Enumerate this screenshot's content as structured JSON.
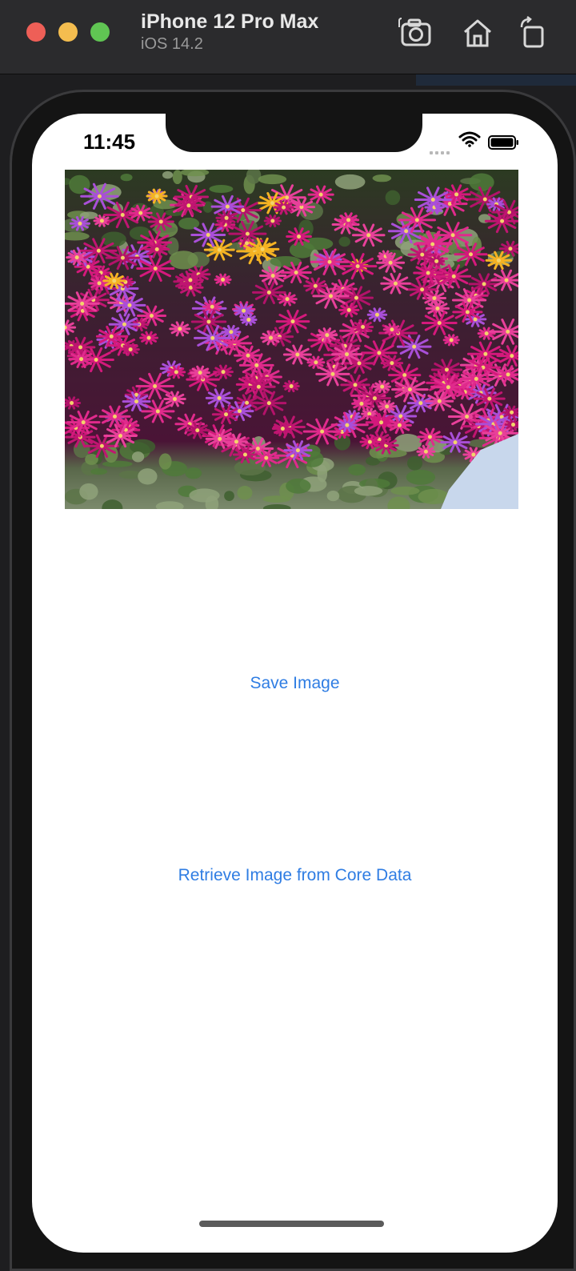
{
  "window": {
    "device_name": "iPhone 12 Pro Max",
    "os_version": "iOS 14.2",
    "toolbar_icons": [
      "screenshot-icon",
      "home-icon",
      "rotate-icon"
    ]
  },
  "status_bar": {
    "time": "11:45"
  },
  "content": {
    "image_subject": "magenta flowers",
    "save_button_label": "Save Image",
    "retrieve_button_label": "Retrieve Image from Core Data"
  },
  "colors": {
    "accent": "#2f7de3",
    "screen_bg": "#ffffff",
    "chrome_bg": "#2b2b2d"
  }
}
